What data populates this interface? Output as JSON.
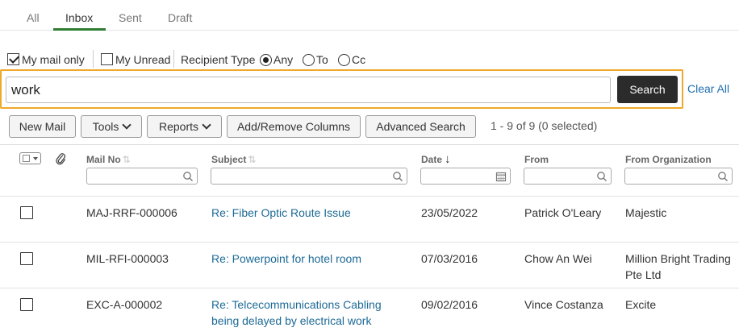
{
  "tabs": [
    {
      "label": "All"
    },
    {
      "label": "Inbox",
      "active": true
    },
    {
      "label": "Sent"
    },
    {
      "label": "Draft"
    }
  ],
  "filters": {
    "my_mail_only": {
      "label": "My mail only",
      "checked": true
    },
    "my_unread": {
      "label": "My Unread",
      "checked": false
    },
    "recipient_type_label": "Recipient Type",
    "recipient_options": [
      {
        "label": "Any",
        "selected": true
      },
      {
        "label": "To",
        "selected": false
      },
      {
        "label": "Cc",
        "selected": false
      }
    ]
  },
  "search": {
    "value": "work",
    "button_label": "Search",
    "clear_label": "Clear All"
  },
  "toolbar": {
    "new_mail": "New Mail",
    "tools": "Tools",
    "reports": "Reports",
    "add_remove_columns": "Add/Remove Columns",
    "advanced_search": "Advanced Search",
    "count_text": "1 - 9 of 9 (0 selected)"
  },
  "table": {
    "columns": {
      "mail_no": "Mail No",
      "subject": "Subject",
      "date": "Date",
      "from": "From",
      "from_org": "From Organization"
    },
    "rows": [
      {
        "mail_no": "MAJ-RRF-000006",
        "subject": "Re: Fiber Optic Route Issue",
        "date": "23/05/2022",
        "from": "Patrick O'Leary",
        "from_org": "Majestic"
      },
      {
        "mail_no": "MIL-RFI-000003",
        "subject": "Re: Powerpoint for hotel room",
        "date": "07/03/2016",
        "from": "Chow An Wei",
        "from_org": "Million Bright Trading Pte Ltd"
      },
      {
        "mail_no": "EXC-A-000002",
        "subject": "Re: Telcecommunications Cabling being delayed by electrical work",
        "date": "09/02/2016",
        "from": "Vince Costanza",
        "from_org": "Excite"
      }
    ]
  },
  "colors": {
    "accent_tab": "#2e7d32",
    "search_highlight": "#f0a92a",
    "link": "#1d6a96",
    "search_button": "#2b2b2b"
  }
}
